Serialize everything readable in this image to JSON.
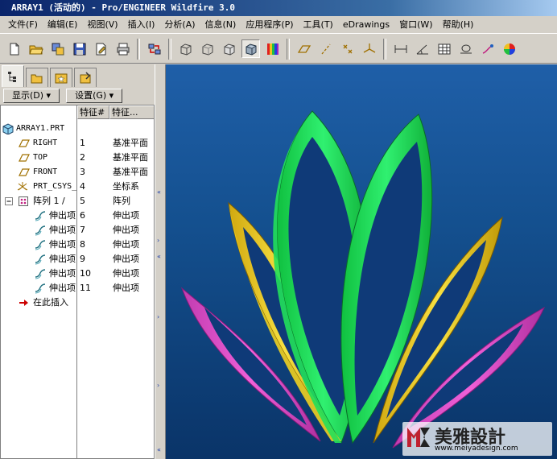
{
  "window": {
    "title": "ARRAY1 (活动的) - Pro/ENGINEER Wildfire 3.0"
  },
  "menu": [
    "文件(F)",
    "编辑(E)",
    "视图(V)",
    "插入(I)",
    "分析(A)",
    "信息(N)",
    "应用程序(P)",
    "工具(T)",
    "eDrawings",
    "窗口(W)",
    "帮助(H)"
  ],
  "toolbar": {
    "buttons": [
      "new-file-icon",
      "open-folder-icon",
      "save-copy-icon",
      "save-icon",
      "print-preview-icon",
      "print-icon",
      "regenerate-icon",
      "view-3d-box-icon",
      "view-wireframe-icon",
      "view-hidden-icon",
      "view-shaded-icon",
      "color-appearance-icon",
      "datum-plane-icon",
      "datum-axis-icon",
      "datum-point-icon",
      "datum-csys-icon",
      "measure-icon",
      "angle-icon",
      "table-icon",
      "section-icon",
      "annotate-icon",
      "color-wheel-icon"
    ]
  },
  "tabs": [
    "model-tree-tab-icon",
    "folder-browser-tab-icon",
    "favorites-tab-icon",
    "connections-tab-icon"
  ],
  "controls": {
    "display_label": "显示(D) ▾",
    "settings_label": "设置(G) ▾"
  },
  "tree": {
    "columns": [
      "特征#",
      "特征..."
    ],
    "root": "ARRAY1.PRT",
    "rows": [
      {
        "label": "RIGHT",
        "num": "1",
        "type": "基准平面",
        "icon": "datum-plane-icon"
      },
      {
        "label": "TOP",
        "num": "2",
        "type": "基准平面",
        "icon": "datum-plane-icon"
      },
      {
        "label": "FRONT",
        "num": "3",
        "type": "基准平面",
        "icon": "datum-plane-icon"
      },
      {
        "label": "PRT_CSYS_",
        "num": "4",
        "type": "坐标系",
        "icon": "csys-icon"
      },
      {
        "label": "阵列 1 /",
        "num": "5",
        "type": "阵列",
        "icon": "pattern-icon"
      },
      {
        "label": "伸出项",
        "num": "6",
        "type": "伸出项",
        "icon": "protrusion-icon"
      },
      {
        "label": "伸出项",
        "num": "7",
        "type": "伸出项",
        "icon": "protrusion-icon"
      },
      {
        "label": "伸出项",
        "num": "8",
        "type": "伸出项",
        "icon": "protrusion-icon"
      },
      {
        "label": "伸出项",
        "num": "9",
        "type": "伸出项",
        "icon": "protrusion-icon"
      },
      {
        "label": "伸出项",
        "num": "10",
        "type": "伸出项",
        "icon": "protrusion-icon"
      },
      {
        "label": "伸出项",
        "num": "11",
        "type": "伸出项",
        "icon": "protrusion-icon"
      }
    ],
    "insert_here": "在此插入"
  },
  "watermark": {
    "text": "美雅設計",
    "url": "www.meiyadesign.com"
  },
  "colors": {
    "green": "#22e05a",
    "yellow": "#f0d020",
    "magenta": "#e04cc8",
    "canvas_top": "#1f5fa8",
    "canvas_bottom": "#0a3468"
  }
}
